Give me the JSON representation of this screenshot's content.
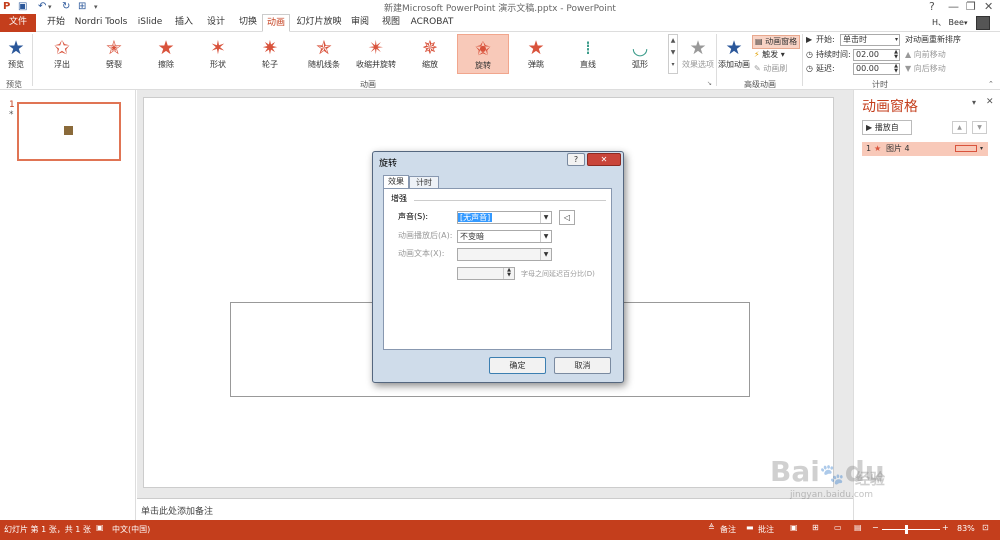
{
  "window": {
    "title": "新建Microsoft PowerPoint 演示文稿.pptx - PowerPoint",
    "help": "?",
    "minimize": "—",
    "restore": "❐",
    "close": "✕",
    "user": "H、 Bee"
  },
  "menu": {
    "items": [
      "文件",
      "开始",
      "Nordri Tools",
      "iSlide",
      "插入",
      "设计",
      "切换",
      "动画",
      "幻灯片放映",
      "审阅",
      "视图",
      "ACROBAT"
    ],
    "active": "动画"
  },
  "ribbon": {
    "preview_label": "预览",
    "preview_group": "预览",
    "effects": [
      "浮出",
      "劈裂",
      "擦除",
      "形状",
      "轮子",
      "随机线条",
      "收缩并旋转",
      "缩放",
      "旋转",
      "弹跳",
      "直线",
      "弧形"
    ],
    "selected_effect": "旋转",
    "effect_options": "效果选项",
    "animation_group": "动画",
    "add_animation": "添加动画",
    "animation_pane_btn": "动画窗格",
    "trigger": "触发",
    "animation_painter": "动画刷",
    "advanced_group": "高级动画",
    "start_label": "开始:",
    "start_value": "单击时",
    "duration_label": "持续时间:",
    "duration_value": "02.00",
    "delay_label": "延迟:",
    "delay_value": "00.00",
    "reorder_label": "对动画重新排序",
    "move_earlier": "向前移动",
    "move_later": "向后移动",
    "timing_group": "计时"
  },
  "slides_panel": {
    "slide_number": "1",
    "slide_marker": "*"
  },
  "notes": {
    "placeholder": "单击此处添加备注"
  },
  "animation_pane": {
    "title": "动画窗格",
    "play_button": "播放自",
    "items": [
      {
        "index": "1",
        "name": "图片 4"
      }
    ]
  },
  "dialog": {
    "title": "旋转",
    "tabs": [
      "效果",
      "计时"
    ],
    "active_tab": "效果",
    "section": "增强",
    "sound_label": "声音(S):",
    "sound_value": "[无声音]",
    "after_label": "动画播放后(A):",
    "after_value": "不变暗",
    "text_label": "动画文本(X):",
    "text_value": "",
    "percent_label": "字母之间延迟百分比(D)",
    "ok": "确定",
    "cancel": "取消"
  },
  "statusbar": {
    "slide_info": "幻灯片 第 1 张，共 1 张",
    "language": "中文(中国)",
    "notes_btn": "备注",
    "comments_btn": "批注",
    "zoom": "83%"
  },
  "watermark": {
    "line1": "Baidu经验",
    "line2": "jingyan.baidu.com"
  },
  "colors": {
    "accent": "#c43e1c",
    "selection": "#f8c9b9",
    "star": "#d9533c"
  }
}
